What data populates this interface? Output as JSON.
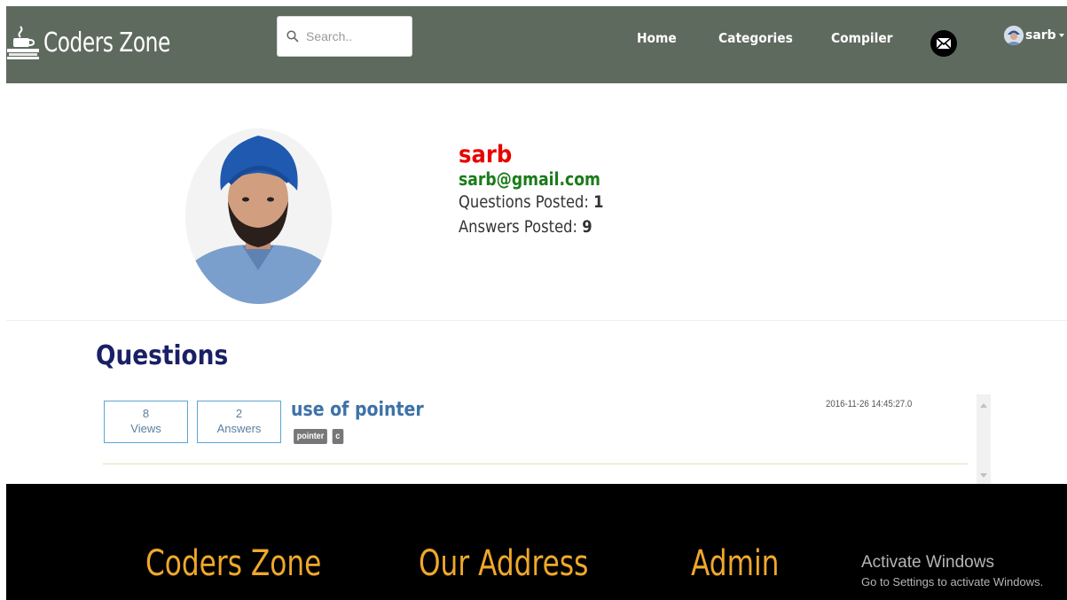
{
  "navbar": {
    "brand": "Coders Zone",
    "search_placeholder": "Search..",
    "links": [
      "Home",
      "Categories",
      "Compiler"
    ],
    "user": "sarb"
  },
  "profile": {
    "name": "sarb",
    "email": "sarb@gmail.com",
    "questions_label": "Questions Posted: ",
    "questions_count": "1",
    "answers_label": "Answers Posted: ",
    "answers_count": "9"
  },
  "questions": {
    "title": "Questions",
    "items": [
      {
        "views": "8",
        "views_label": "Views",
        "answers": "2",
        "answers_label": "Answers",
        "title": "use of pointer",
        "tags": [
          "pointer",
          "c"
        ],
        "timestamp": "2016-11-26 14:45:27.0"
      }
    ]
  },
  "footer": {
    "columns": [
      "Coders Zone",
      "Our Address",
      "Admin"
    ]
  },
  "os_overlay": {
    "title": "Activate Windows",
    "subtitle": "Go to Settings to activate Windows."
  },
  "colors": {
    "navbar_bg": "#5f6a5f",
    "profile_name": "#e80000",
    "profile_email": "#1a7b1a",
    "section_title": "#1a2066",
    "question_link": "#3d72a8",
    "footer_bg": "#000000",
    "footer_heading": "#f0a82a"
  }
}
